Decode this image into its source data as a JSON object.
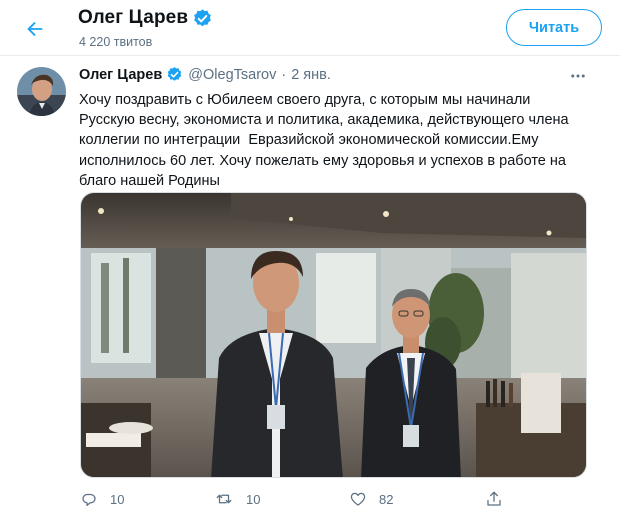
{
  "header": {
    "name": "Олег Царев",
    "tweet_count": "4 220 твитов",
    "follow_label": "Читать"
  },
  "tweet": {
    "author_name": "Олег Царев",
    "handle": "@OlegTsarov",
    "separator": "·",
    "date": "2 янв.",
    "text_lines": [
      "Хочу поздравить с Юбилеем своего друга, с которым мы начинали",
      "Русскую весну, экономиста и политика, академика, действующего члена",
      "коллегии по интеграции  Евразийской экономической комиссии.Ему",
      "исполнилось 60 лет. Хочу пожелать ему здоровья и успехов в работе на",
      "благо нашей Родины"
    ]
  },
  "actions": {
    "reply_count": "10",
    "retweet_count": "10",
    "like_count": "82"
  },
  "colors": {
    "accent": "#1da1f2",
    "secondary_text": "#5b7083",
    "border": "#e6ecf0"
  },
  "icons": [
    "back-arrow-icon",
    "verified-badge-icon",
    "more-icon",
    "reply-icon",
    "retweet-icon",
    "like-icon",
    "share-icon"
  ]
}
